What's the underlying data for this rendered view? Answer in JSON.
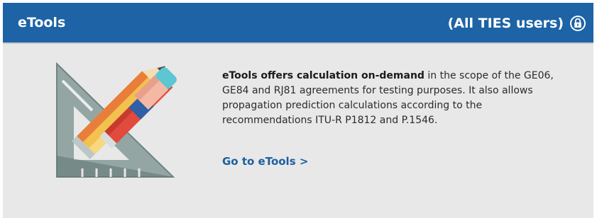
{
  "header": {
    "title": "eTools",
    "access_label": "(All TIES users)",
    "access_icon": "lock-icon",
    "background_color": "#1d63a5"
  },
  "illustration": {
    "icon": "drafting-tools-icon"
  },
  "description": {
    "lead": "eTools offers calculation on-demand",
    "body": " in the scope of the GE06, GE84 and RJ81 agreements for testing purposes. It also allows propagation prediction calculations according to the recommendations ITU-R P1812 and P.1546."
  },
  "link": {
    "label": "Go to eTools >",
    "color": "#1d5f9e"
  }
}
